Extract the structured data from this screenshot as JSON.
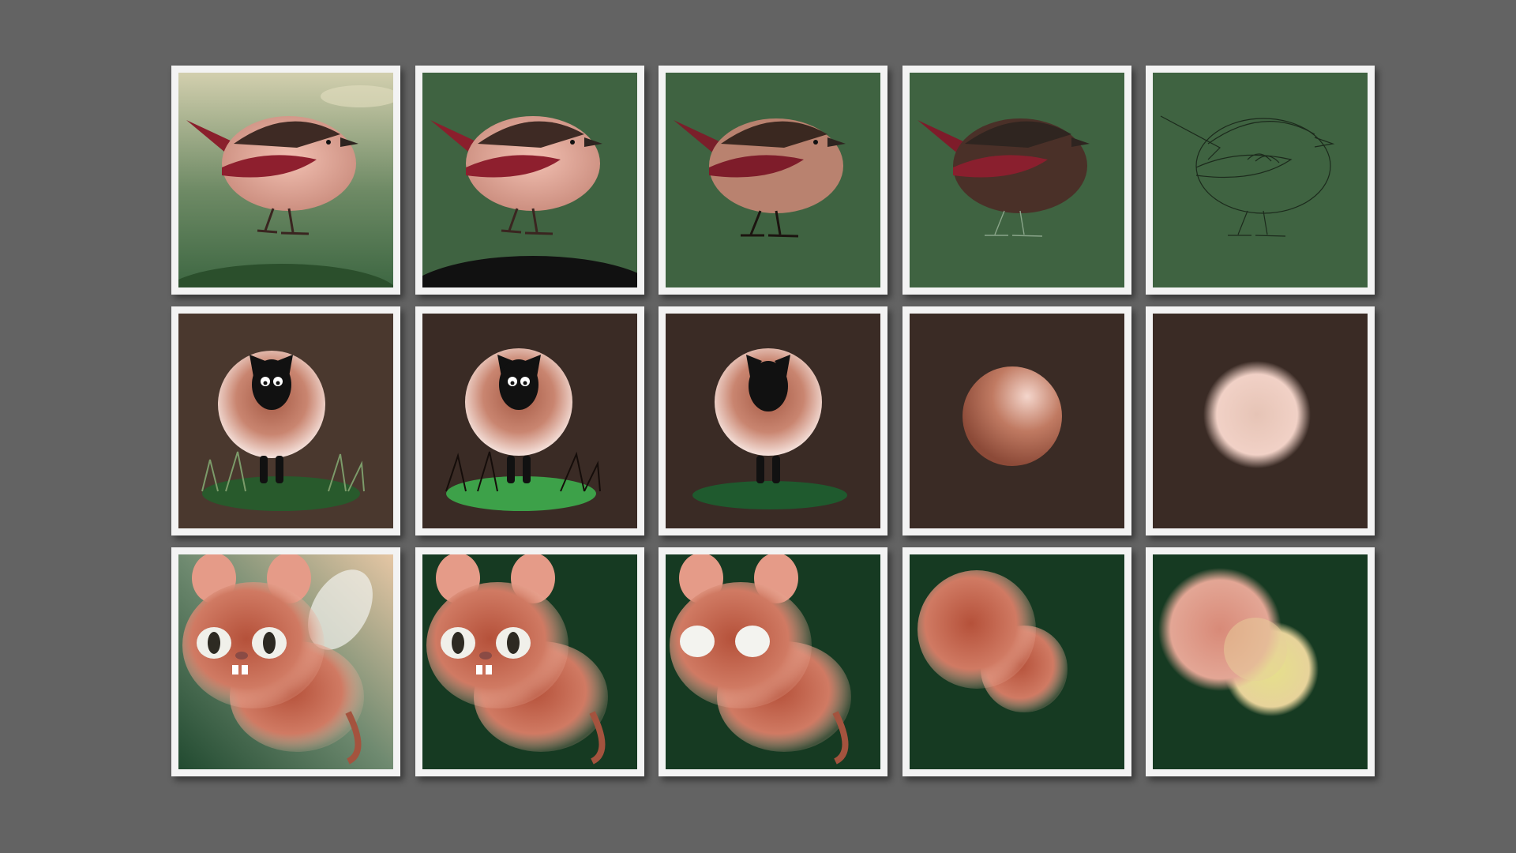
{
  "gallery": {
    "rows": [
      {
        "subject": "robin",
        "stages": [
          "finished",
          "flat-background",
          "shaded",
          "base-colors",
          "line-sketch"
        ]
      },
      {
        "subject": "sheep",
        "stages": [
          "finished",
          "grass-added",
          "silhouette",
          "shaded-ball",
          "base-ball"
        ]
      },
      {
        "subject": "winged-critter",
        "stages": [
          "finished",
          "eyes-detailed",
          "eyes-base",
          "body-blobs",
          "color-blocks"
        ]
      }
    ]
  },
  "colors": {
    "page_background": "#636363",
    "frame": "#f3f3f3",
    "robin_bg": "#3f6341",
    "sheep_bg": "#3a2b25",
    "critter_bg": "#163a22"
  }
}
